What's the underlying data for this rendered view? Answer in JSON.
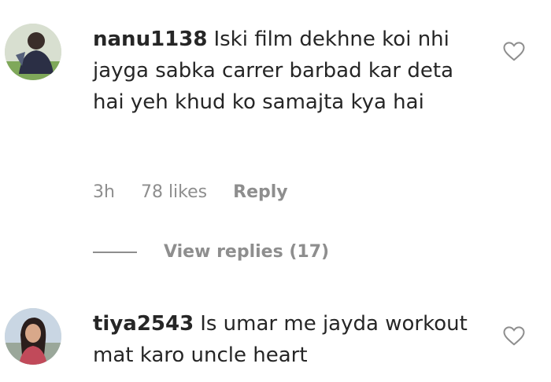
{
  "comments": [
    {
      "username": "nanu1138",
      "text": "Iski film dekhne koi nhi jayga sabka carrer barbad kar deta hai yeh khud ko samajta kya hai",
      "time": "3h",
      "likes": "78 likes",
      "reply_label": "Reply",
      "view_replies": "View replies (17)",
      "heart_icon": "heart-outline-icon"
    },
    {
      "username": "tiya2543",
      "text": "Is umar me jayda workout mat karo uncle heart",
      "heart_icon": "heart-outline-icon"
    }
  ]
}
